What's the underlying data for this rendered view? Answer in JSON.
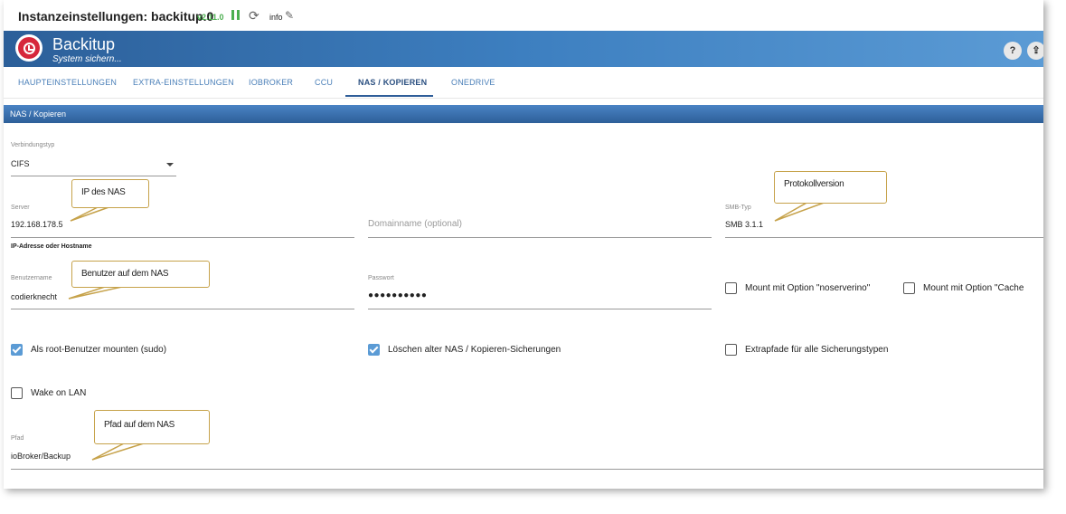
{
  "window": {
    "title": "Instanzeinstellungen: backitup.0",
    "version": "v2.11.0",
    "info_label": "info"
  },
  "header": {
    "app_name": "Backitup",
    "subtitle": "System sichern...",
    "help_button": "?",
    "upload_button": "⇪"
  },
  "tabs": [
    {
      "label": "HAUPTEINSTELLUNGEN"
    },
    {
      "label": "EXTRA-EINSTELLUNGEN"
    },
    {
      "label": "IOBROKER"
    },
    {
      "label": "CCU"
    },
    {
      "label": "NAS / KOPIEREN",
      "active": true
    },
    {
      "label": "ONEDRIVE"
    }
  ],
  "section": {
    "title": "NAS / Kopieren"
  },
  "form": {
    "connection_type": {
      "label": "Verbindungstyp",
      "value": "CIFS"
    },
    "server": {
      "label": "Server",
      "value": "192.168.178.5",
      "helper": "IP-Adresse oder Hostname"
    },
    "domain": {
      "placeholder": "Domainname (optional)"
    },
    "smb_type": {
      "label": "SMB-Typ",
      "value": "SMB 3.1.1"
    },
    "username": {
      "label": "Benutzername",
      "value": "codierknecht"
    },
    "password": {
      "label": "Passwort",
      "value": "●●●●●●●●●●"
    },
    "checkboxes": [
      {
        "label": "Mount mit Option \"noserverino\"",
        "checked": false
      },
      {
        "label": "Mount mit Option \"Cache",
        "checked": false
      },
      {
        "label": "Als root-Benutzer mounten (sudo)",
        "checked": true
      },
      {
        "label": "Löschen alter NAS / Kopieren-Sicherungen",
        "checked": true
      },
      {
        "label": "Extrapfade für alle Sicherungstypen",
        "checked": false
      },
      {
        "label": "Wake on LAN",
        "checked": false
      }
    ],
    "path": {
      "label": "Pfad",
      "value": "ioBroker/Backup"
    }
  },
  "callouts": [
    {
      "text": "IP des NAS"
    },
    {
      "text": "Protokollversion"
    },
    {
      "text": "Benutzer auf dem NAS"
    },
    {
      "text": "Pfad auf dem NAS"
    }
  ],
  "colors": {
    "header_start": "#2c5f99",
    "header_end": "#5b9bd5",
    "version_green": "#4caf50",
    "checkbox_blue": "#5b9bd5",
    "callout_border": "#c6a24a",
    "logo_red": "#d6263b"
  }
}
